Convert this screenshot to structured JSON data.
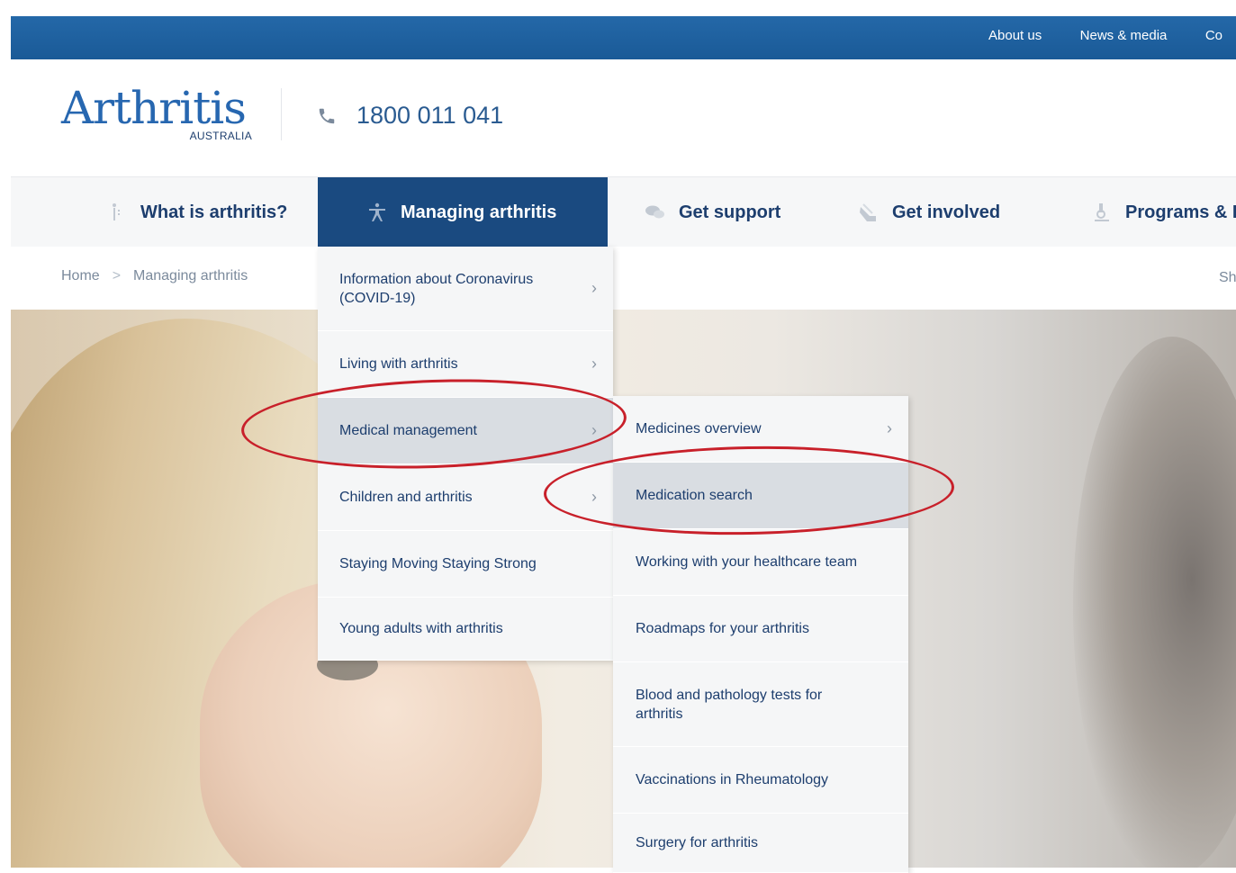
{
  "utility_bar": {
    "links": [
      "About us",
      "News & media",
      "Co"
    ]
  },
  "header": {
    "logo_text": "Arthritis",
    "logo_sub": "AUSTRALIA",
    "phone": "1800 011 041"
  },
  "main_nav": {
    "items": [
      {
        "label": "What is arthritis?",
        "icon": "info-person-icon"
      },
      {
        "label": "Managing arthritis",
        "icon": "person-icon",
        "active": true
      },
      {
        "label": "Get support",
        "icon": "chat-bubbles-icon"
      },
      {
        "label": "Get involved",
        "icon": "hand-wave-icon"
      },
      {
        "label": "Programs & I",
        "icon": "microscope-icon"
      }
    ]
  },
  "breadcrumb": {
    "items": [
      "Home",
      "Managing arthritis"
    ],
    "share": "Sh"
  },
  "menu_level1": {
    "items": [
      {
        "label": "Information about Coronavirus (COVID-19)",
        "has_submenu": true
      },
      {
        "label": "Living with arthritis",
        "has_submenu": true
      },
      {
        "label": "Medical management",
        "has_submenu": true,
        "selected": true
      },
      {
        "label": "Children and arthritis",
        "has_submenu": true
      },
      {
        "label": "Staying Moving Staying Strong",
        "has_submenu": false
      },
      {
        "label": "Young adults with arthritis",
        "has_submenu": false
      }
    ]
  },
  "menu_level2": {
    "items": [
      {
        "label": "Medicines overview",
        "has_submenu": true
      },
      {
        "label": "Medication search",
        "has_submenu": false,
        "selected": true
      },
      {
        "label": "Working with your healthcare team",
        "has_submenu": false
      },
      {
        "label": "Roadmaps for your arthritis",
        "has_submenu": false
      },
      {
        "label": "Blood and pathology tests for arthritis",
        "has_submenu": false
      },
      {
        "label": "Vaccinations in Rheumatology",
        "has_submenu": false
      },
      {
        "label": "Surgery for arthritis",
        "has_submenu": false
      }
    ]
  },
  "colors": {
    "utility_bar": "#1a5a97",
    "nav_active": "#1a4a80",
    "text_primary": "#1d3e6e",
    "annotation_red": "#c8202a"
  }
}
